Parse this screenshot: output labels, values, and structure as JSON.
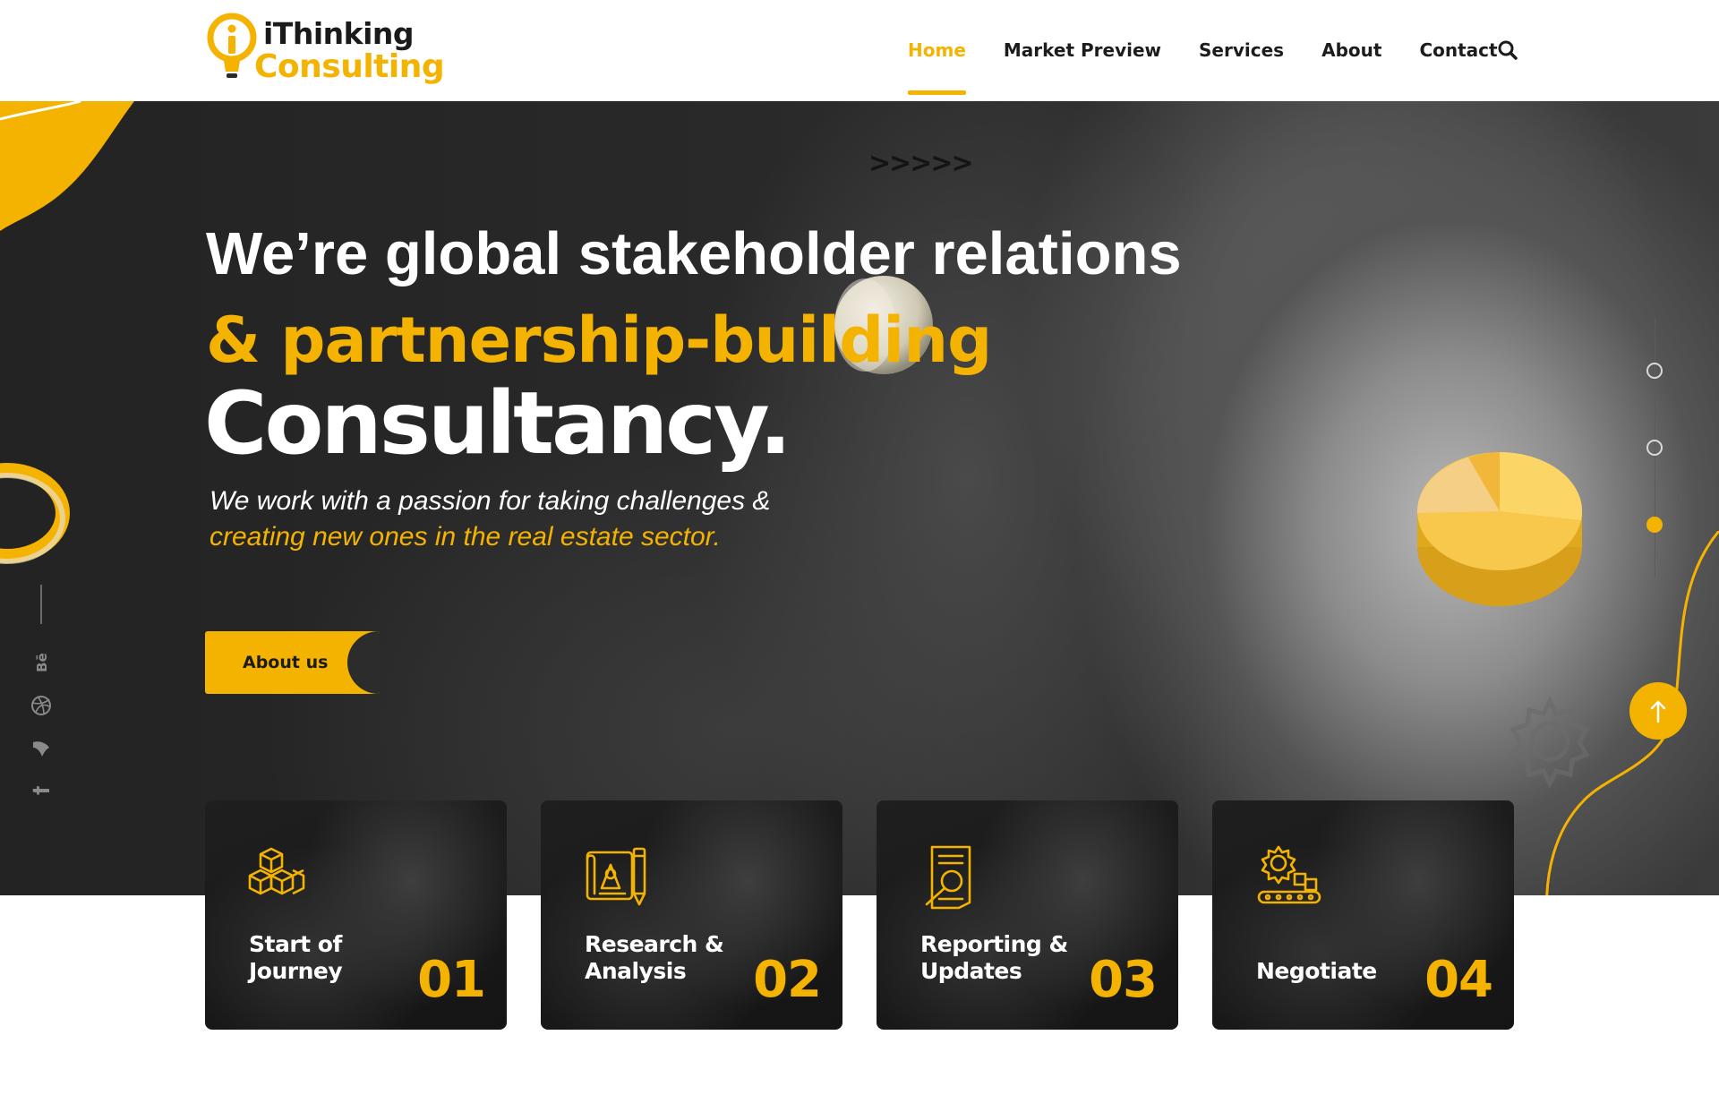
{
  "brand": {
    "name_line1": "iThinking",
    "name_line2": "Consulting",
    "accent_color": "#f5b301",
    "logo_icon": "lightbulb-icon"
  },
  "nav": {
    "items": [
      {
        "label": "Home",
        "active": true
      },
      {
        "label": "Market Preview",
        "active": false
      },
      {
        "label": "Services",
        "active": false
      },
      {
        "label": "About",
        "active": false
      },
      {
        "label": "Contact",
        "active": false
      }
    ],
    "search_icon": "search-icon"
  },
  "hero": {
    "chevrons": ">>>>>",
    "headline_line1": "We’re global stakeholder relations",
    "headline_line2": "& partnership-building",
    "headline_line3": "Consultancy.",
    "subtitle_line1": "We work with a passion for taking challenges &",
    "subtitle_line2": "creating new ones in the real estate sector.",
    "cta_label": "About us",
    "slider": {
      "count": 3,
      "active_index": 2
    },
    "social_icons": [
      "behance-icon",
      "dribbble-icon",
      "vimeo-icon",
      "facebook-icon"
    ],
    "scroll_top_icon": "arrow-up-icon"
  },
  "services": [
    {
      "title_line1": "Start of",
      "title_line2": "Journey",
      "number": "01",
      "icon": "cubes-icon"
    },
    {
      "title_line1": "Research &",
      "title_line2": "Analysis",
      "number": "02",
      "icon": "blueprint-icon"
    },
    {
      "title_line1": "Reporting &",
      "title_line2": "Updates",
      "number": "03",
      "icon": "report-search-icon"
    },
    {
      "title_line1": "",
      "title_line2": "Negotiate",
      "number": "04",
      "icon": "gear-conveyor-icon"
    }
  ]
}
